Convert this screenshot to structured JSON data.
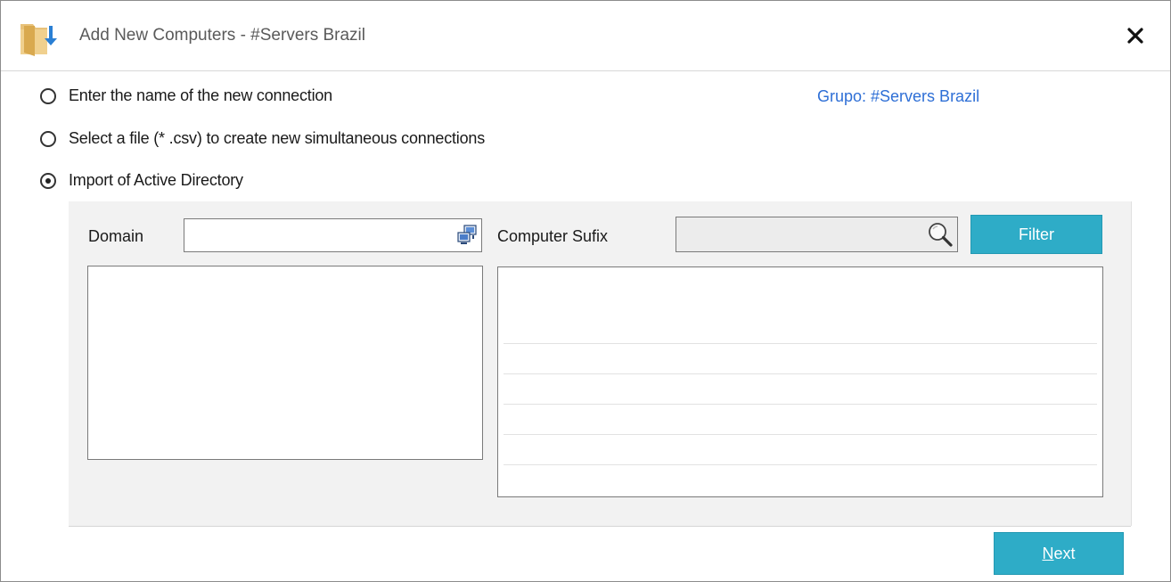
{
  "window": {
    "title": "Add New Computers - #Servers Brazil",
    "close_glyph": "✕"
  },
  "options": [
    {
      "label": "Enter the name of the new connection",
      "checked": false
    },
    {
      "label": "Select a file (* .csv) to create new simultaneous connections",
      "checked": false
    },
    {
      "label": "Import of Active Directory",
      "checked": true
    }
  ],
  "group_link": "Grupo: #Servers Brazil",
  "import_panel": {
    "domain_label": "Domain",
    "domain_value": "",
    "computer_sufix_label": "Computer Sufix",
    "computer_sufix_value": "",
    "filter_label": "Filter"
  },
  "footer": {
    "next_mnemonic": "N",
    "next_rest": "ext"
  },
  "colors": {
    "accent": "#2eacc7",
    "link": "#2e6fd6",
    "panel_bg": "#f2f2f2"
  },
  "icons": {
    "app": "folder-download-icon",
    "close": "close-icon",
    "domain_browse": "network-computers-icon",
    "search": "search-icon"
  }
}
